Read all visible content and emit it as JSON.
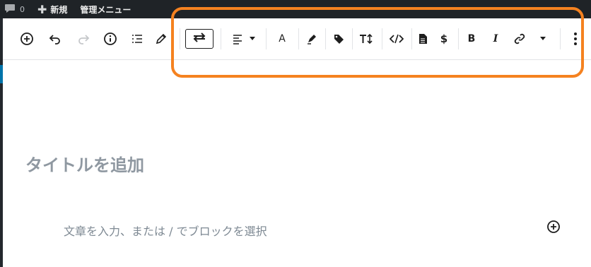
{
  "admin_bar": {
    "comment_count": "0",
    "new_label": "新規",
    "menu_label": "管理メニュー"
  },
  "toolbar": {
    "left_tools": [
      "add-block-icon",
      "undo-icon",
      "redo-icon",
      "info-icon",
      "outline-icon",
      "edit-icon"
    ],
    "format_tools": [
      "switch-icon",
      "align-left-icon",
      "dropdown-caret-icon",
      "text-color-icon",
      "highlighter-icon",
      "tag-icon",
      "font-size-icon",
      "code-icon",
      "document-icon",
      "dollar-icon",
      "bold-icon",
      "italic-icon",
      "link-icon",
      "dropdown-caret-icon",
      "more-options-icon"
    ],
    "text_color_glyph": "A",
    "bold_glyph": "B",
    "italic_glyph": "I"
  },
  "editor": {
    "title_placeholder": "タイトルを追加",
    "paragraph_placeholder": "文章を入力、または / でブロックを選択"
  },
  "colors": {
    "admin_bar_bg": "#1f2327",
    "annotation": "#f58220",
    "placeholder_title": "#8f98a1",
    "placeholder_text": "#7e8993",
    "accent": "#0073aa"
  }
}
